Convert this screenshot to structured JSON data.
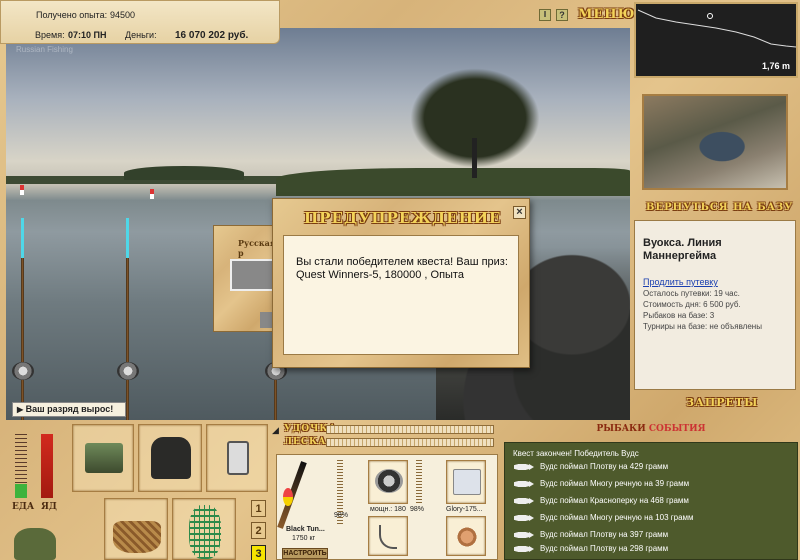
{
  "header": {
    "exp_label": "Получено опыта:",
    "exp_value": "94500",
    "time_label": "Время:",
    "time_value": "07:10 ПН",
    "money_label": "Деньги:",
    "money_value": "16 070 202 руб.",
    "watermark": "Russian Fishing",
    "menu_label": "МЕНЮ"
  },
  "depth": {
    "value": "1,76 m"
  },
  "scene": {
    "rank_up_text": "Ваш разряд вырос!",
    "ghost_title": "Русская р"
  },
  "dialog": {
    "title": "ПРЕДУПРЕЖДЕНИЕ",
    "message": "Вы стали победителем квеста! Ваш приз: Quest Winners-5, 180000 , Опыта"
  },
  "side": {
    "return_button": "ВЕРНУТЬСЯ НА БАЗУ",
    "location_name": "Вуокса. Линия Маннергейма",
    "extend_link": "Продлить путевку",
    "info": [
      "Осталось путевки: 19 час.",
      "Стоимость дня: 6 500 руб.",
      "Рыбаков на базе: 3",
      "Турниры на базе: не объявлены"
    ],
    "bans_button": "ЗАПРЕТЫ"
  },
  "status": {
    "food_label": "ЕДА",
    "poison_label": "ЯД"
  },
  "gear": {
    "rod_label": "УДОЧКА",
    "line_label": "ЛЕСКА",
    "rod_name": "Black Tun...",
    "rod_weight": "1750 кг",
    "rod_percent": "98%",
    "setup_button": "НАСТРОИТЬ",
    "reel_name": "мощн.: 180",
    "reel_percent": "98%",
    "line_name": "Glory-175..."
  },
  "slots": {
    "numbers": [
      "1",
      "2",
      "3"
    ]
  },
  "events": {
    "title_part1": "РЫБАКИ",
    "title_part2": "СОБЫТИЯ",
    "items": [
      "Квест закончен! Победитель Вудс",
      "Вудс поймал Плотву на 429 грамм",
      "Вудс поймал Многу речную на 39 грамм",
      "Вудс поймал Красноперку на 468 грамм",
      "Вудс поймал Многу речную на 103 грамм",
      "Вудс поймал Плотву на 397 грамм",
      "Вудс поймал Плотву на 298 грамм"
    ]
  },
  "colors": {
    "accent_gold": "#f3d35a",
    "events_bg": "#4e5a2c",
    "food_green": "#3db33d",
    "poison_red": "#d22a1e"
  }
}
